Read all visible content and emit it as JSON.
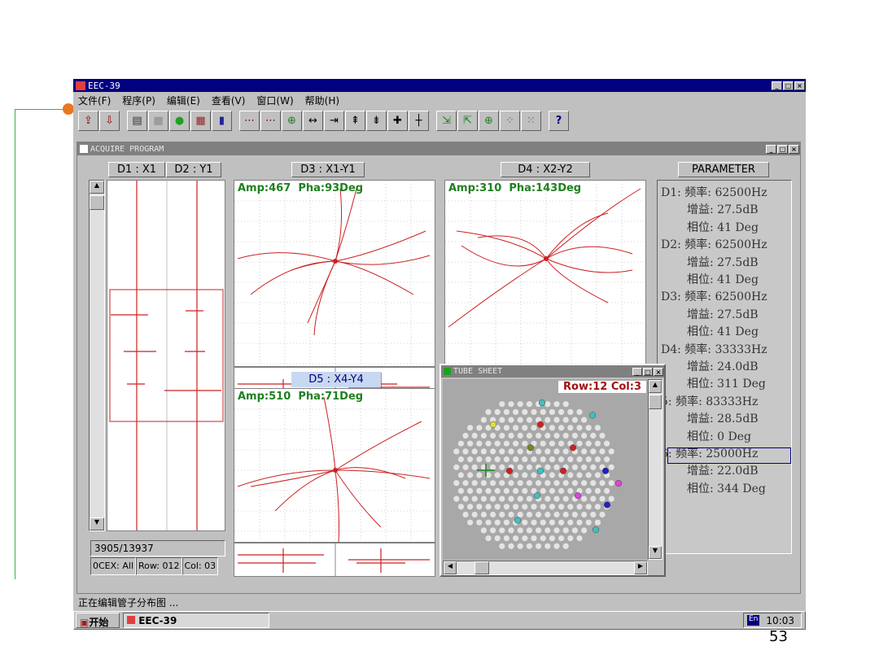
{
  "app": {
    "title": "EEC-39"
  },
  "menu": [
    "文件(F)",
    "程序(P)",
    "编辑(E)",
    "查看(V)",
    "窗口(W)",
    "帮助(H)"
  ],
  "toolbar_icons": [
    "open-icon",
    "save-icon",
    "print-icon",
    "grid-icon",
    "globe-icon",
    "table-icon",
    "bar-chart-icon",
    "signal-icon",
    "signal2-icon",
    "crosshair-icon",
    "arrow-left-icon",
    "arrow-left2-icon",
    "up-icon",
    "down-icon",
    "cross-icon",
    "plus-icon",
    "export-icon",
    "edit-icon",
    "target-icon",
    "dots-icon",
    "dots2-icon",
    "help-icon"
  ],
  "inner_window": {
    "title": "ACQUIRE PROGRAM"
  },
  "panels": {
    "strip": {
      "h1": "D1 : X1",
      "h2": "D2 : Y1",
      "counter": "3905/13937",
      "status": {
        "ocex": "0CEX: All",
        "row": "Row: 012",
        "col": "Col: 03"
      }
    },
    "d3": {
      "header": "D3 : X1-Y1",
      "amp": "Amp:467",
      "pha": "Pha:93Deg"
    },
    "d4": {
      "header": "D4 : X2-Y2",
      "amp": "Amp:310",
      "pha": "Pha:143Deg"
    },
    "d5": {
      "header": "D5 : X4-Y4",
      "amp": "Amp:510",
      "pha": "Pha:71Deg"
    }
  },
  "parameter": {
    "header": "PARAMETER",
    "lines": [
      "D1: 频率: 62500Hz",
      "增益: 27.5dB",
      "相位: 41 Deg",
      "D2: 频率: 62500Hz",
      "增益: 27.5dB",
      "相位: 41 Deg",
      "D3: 频率: 62500Hz",
      "增益: 27.5dB",
      "相位: 41 Deg",
      "D4: 频率: 33333Hz",
      "增益: 24.0dB",
      "相位: 311 Deg",
      "5: 频率: 83333Hz",
      "增益: 28.5dB",
      "相位: 0 Deg",
      "6: 频率: 25000Hz",
      "增益: 22.0dB",
      "相位: 344 Deg"
    ]
  },
  "tube_sheet": {
    "title": "TUBE SHEET",
    "position": "Row:12  Col:3",
    "markers": [
      {
        "r": 0.08,
        "c": 0.55,
        "color": "#40c0c0"
      },
      {
        "r": 0.16,
        "c": 0.86,
        "color": "#40c0c0"
      },
      {
        "r": 0.22,
        "c": 0.25,
        "color": "#e0e040"
      },
      {
        "r": 0.22,
        "c": 0.54,
        "color": "#d02020"
      },
      {
        "r": 0.37,
        "c": 0.48,
        "color": "#808020"
      },
      {
        "r": 0.37,
        "c": 0.74,
        "color": "#d02020"
      },
      {
        "r": 0.52,
        "c": 0.35,
        "color": "#d02020"
      },
      {
        "r": 0.52,
        "c": 0.54,
        "color": "#40c0c0"
      },
      {
        "r": 0.52,
        "c": 0.68,
        "color": "#d02020"
      },
      {
        "r": 0.52,
        "c": 0.94,
        "color": "#2020c0"
      },
      {
        "r": 0.6,
        "c": 1.02,
        "color": "#e040e0"
      },
      {
        "r": 0.68,
        "c": 0.52,
        "color": "#40c0c0"
      },
      {
        "r": 0.68,
        "c": 0.77,
        "color": "#e040e0"
      },
      {
        "r": 0.74,
        "c": 0.95,
        "color": "#2020c0"
      },
      {
        "r": 0.84,
        "c": 0.4,
        "color": "#40c0c0"
      },
      {
        "r": 0.9,
        "c": 0.88,
        "color": "#40c0c0"
      }
    ]
  },
  "status_bar": {
    "text": "正在编辑管子分布图 ..."
  },
  "taskbar": {
    "start": "开始",
    "task": "EEC-39",
    "tray_ime": "En",
    "clock": "10:03"
  },
  "page_number": "53",
  "colors": {
    "trace": "#cc2020",
    "amp_text": "#208020",
    "title_bar": "#000080"
  }
}
